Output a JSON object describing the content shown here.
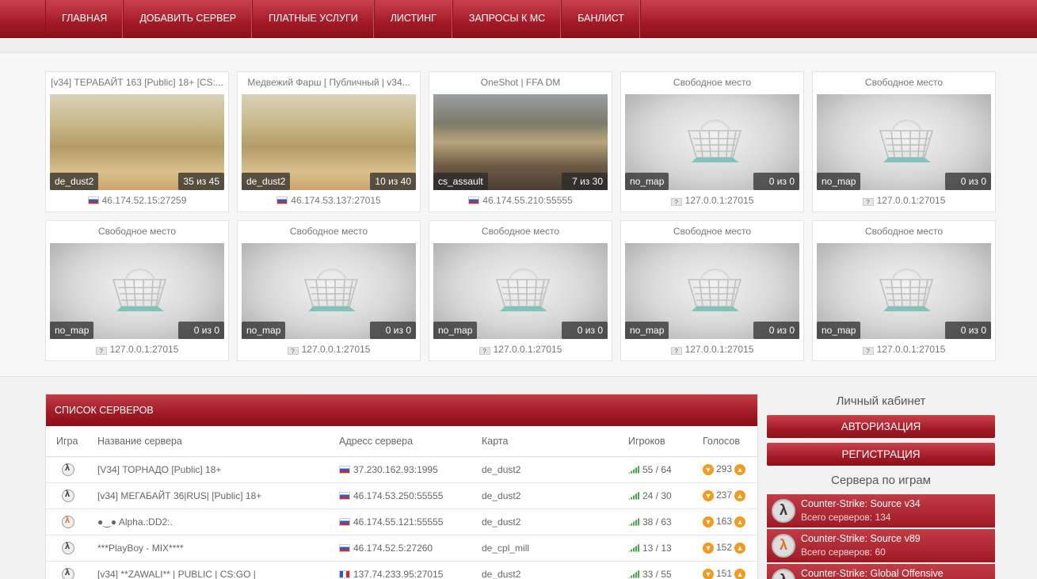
{
  "nav": {
    "items": [
      "ГЛАВНАЯ",
      "ДОБАВИТЬ СЕРВЕР",
      "ПЛАТНЫЕ УСЛУГИ",
      "ЛИСТИНГ",
      "ЗАПРОСЫ К МС",
      "БАНЛИСТ"
    ]
  },
  "featured": [
    {
      "title": "[v34] ТЕРАБАЙТ 163 [Public] 18+ [CS:...",
      "map": "de_dust2",
      "players": "35 из 45",
      "address": "46.174.52.15:27259",
      "flag": "ru",
      "thumb": "dust"
    },
    {
      "title": "Медвежий Фарш [ Публичный | v34...",
      "map": "de_dust2",
      "players": "10 из 40",
      "address": "46.174.53.137:27015",
      "flag": "ru",
      "thumb": "dust"
    },
    {
      "title": "OneShot | FFA DM",
      "map": "cs_assault",
      "players": "7 из 30",
      "address": "46.174.55.210:55555",
      "flag": "ru",
      "thumb": "assault"
    },
    {
      "title": "Свободное место",
      "map": "no_map",
      "players": "0 из 0",
      "address": "127.0.0.1:27015",
      "flag": "unknown",
      "thumb": "empty"
    },
    {
      "title": "Свободное место",
      "map": "no_map",
      "players": "0 из 0",
      "address": "127.0.0.1:27015",
      "flag": "unknown",
      "thumb": "empty"
    },
    {
      "title": "Свободное место",
      "map": "no_map",
      "players": "0 из 0",
      "address": "127.0.0.1:27015",
      "flag": "unknown",
      "thumb": "empty"
    },
    {
      "title": "Свободное место",
      "map": "no_map",
      "players": "0 из 0",
      "address": "127.0.0.1:27015",
      "flag": "unknown",
      "thumb": "empty"
    },
    {
      "title": "Свободное место",
      "map": "no_map",
      "players": "0 из 0",
      "address": "127.0.0.1:27015",
      "flag": "unknown",
      "thumb": "empty"
    },
    {
      "title": "Свободное место",
      "map": "no_map",
      "players": "0 из 0",
      "address": "127.0.0.1:27015",
      "flag": "unknown",
      "thumb": "empty"
    },
    {
      "title": "Свободное место",
      "map": "no_map",
      "players": "0 из 0",
      "address": "127.0.0.1:27015",
      "flag": "unknown",
      "thumb": "empty"
    }
  ],
  "server_list": {
    "title": "СПИСОК СЕРВЕРОВ",
    "columns": [
      "Игра",
      "Название сервера",
      "Адресс сервера",
      "Карта",
      "Игроков",
      "Голосов"
    ],
    "rows": [
      {
        "game_icon": "css-icon",
        "name": "[V34] ТОРНАДО [Public] 18+",
        "flag": "ru",
        "address": "37.230.162.93:1995",
        "map": "de_dust2",
        "players": "55 / 64",
        "votes": "293"
      },
      {
        "game_icon": "css-icon",
        "name": "[v34] МЕГАБАЙТ 36|RUS| [Public] 18+",
        "flag": "ru",
        "address": "46.174.53.250:55555",
        "map": "de_dust2",
        "players": "24 / 30",
        "votes": "237"
      },
      {
        "game_icon": "css-v89-icon",
        "name": "●‿● Alpha.:DD2:.",
        "flag": "ru",
        "address": "46.174.55.121:55555",
        "map": "de_dust2",
        "players": "38 / 63",
        "votes": "163"
      },
      {
        "game_icon": "css-icon",
        "name": "***PlayBoy - MIX****",
        "flag": "ru",
        "address": "46.174.52.5:27260",
        "map": "de_cpl_mill",
        "players": "13 / 13",
        "votes": "152"
      },
      {
        "game_icon": "css-icon",
        "name": "[v34] **ZAWALI** | PUBLIC | CS:GO |",
        "flag": "fr",
        "address": "137.74.233.95:27015",
        "map": "de_dust2",
        "players": "33 / 55",
        "votes": "151"
      }
    ]
  },
  "sidebar": {
    "cabinet_title": "Личный кабинет",
    "login_label": "АВТОРИЗАЦИЯ",
    "register_label": "РЕГИСТРАЦИЯ",
    "games_title": "Сервера по играм",
    "games": [
      {
        "name": "Counter-Strike: Source v34",
        "count": "Всего серверов: 134",
        "icon": "css-icon"
      },
      {
        "name": "Counter-Strike: Source v89",
        "count": "Всего серверов: 60",
        "icon": "css-v89-icon"
      },
      {
        "name": "Counter-Strike: Global Offensive",
        "count": "",
        "icon": "csgo-icon"
      }
    ]
  },
  "colors": {
    "accent": "#a31b27",
    "accent_light": "#c9424b",
    "vote": "#f39b1f"
  }
}
